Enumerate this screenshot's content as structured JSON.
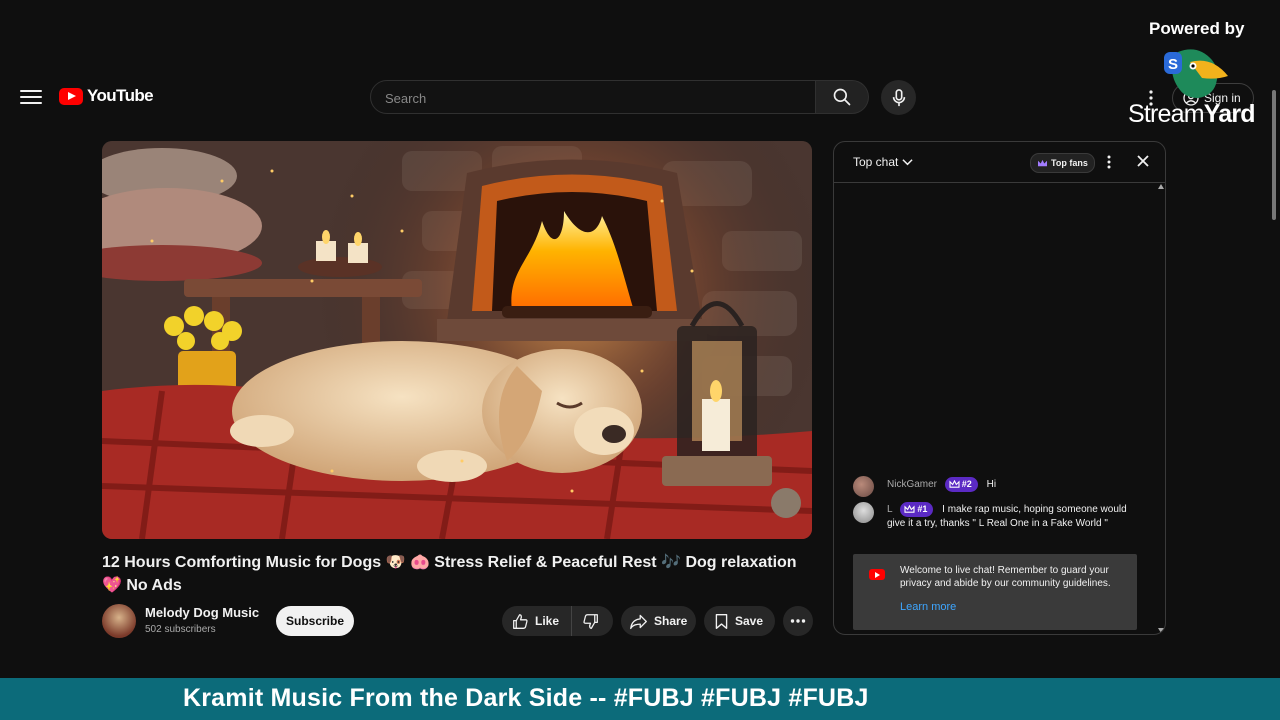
{
  "header": {
    "logo_text": "YouTube",
    "search_placeholder": "Search",
    "signin_label": "Sign in"
  },
  "video": {
    "title": "12 Hours Comforting Music for Dogs 🐶 🐽 Stress Relief & Peaceful Rest 🎶 Dog relaxation 💖 No Ads",
    "channel_name": "Melody Dog Music",
    "subscribers": "502 subscribers",
    "subscribe_label": "Subscribe",
    "like_label": "Like",
    "share_label": "Share",
    "save_label": "Save"
  },
  "chat": {
    "mode_label": "Top chat",
    "top_fans_label": "Top fans",
    "messages": [
      {
        "author": "NickGamer",
        "rank": "#2",
        "text": "Hi"
      },
      {
        "author": "L",
        "rank": "#1",
        "text": "I make rap music, hoping someone would give it a try, thanks \" L Real One in a Fake World \""
      }
    ],
    "welcome_text": "Welcome to live chat! Remember to guard your privacy and abide by our community guidelines.",
    "learn_more": "Learn more"
  },
  "overlay": {
    "powered_by": "Powered by",
    "brand_stream": "Stream",
    "brand_yard": "Yard",
    "banner_text": "Kramit Music From the Dark Side -- #FUBJ #FUBJ #FUBJ"
  },
  "colors": {
    "page_bg": "#0f0f0f",
    "youtube_red": "#ff0000",
    "banner_bg": "#0c6b7a",
    "rank_badge": "#5b2ac4",
    "link_blue": "#3ea6ff"
  },
  "icons": [
    "menu-icon",
    "search-icon",
    "mic-icon",
    "more-vert-icon",
    "account-icon",
    "thumb-up-icon",
    "thumb-down-icon",
    "share-icon",
    "bookmark-icon",
    "more-horiz-icon",
    "chevron-down-icon",
    "crown-icon",
    "close-icon"
  ]
}
